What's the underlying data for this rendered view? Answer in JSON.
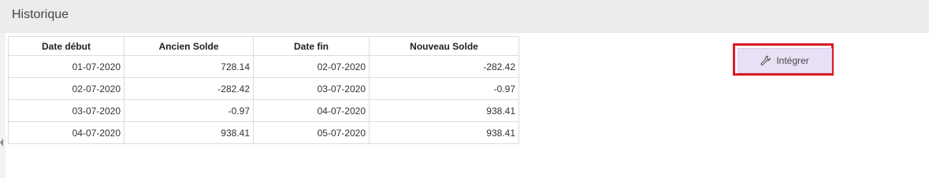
{
  "header": {
    "title": "Historique"
  },
  "table": {
    "columns": [
      "Date début",
      "Ancien Solde",
      "Date fin",
      "Nouveau Solde"
    ],
    "rows": [
      [
        "01-07-2020",
        "728.14",
        "02-07-2020",
        "-282.42"
      ],
      [
        "02-07-2020",
        "-282.42",
        "03-07-2020",
        "-0.97"
      ],
      [
        "03-07-2020",
        "-0.97",
        "04-07-2020",
        "938.41"
      ],
      [
        "04-07-2020",
        "938.41",
        "05-07-2020",
        "938.41"
      ]
    ]
  },
  "actions": {
    "integrer_label": "Intégrer",
    "integrer_icon": "wrench-icon"
  },
  "colors": {
    "header_bg": "#ececec",
    "button_bg": "#e8e0f4",
    "highlight_border": "#d81b24"
  }
}
